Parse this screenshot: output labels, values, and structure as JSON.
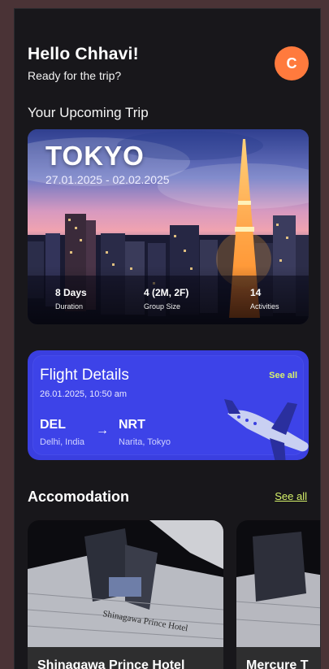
{
  "header": {
    "greeting": "Hello Chhavi!",
    "subtitle": "Ready for the trip?",
    "avatar_initial": "C"
  },
  "upcoming": {
    "section_title": "Your Upcoming Trip",
    "city": "TOKYO",
    "dates": "27.01.2025 - 02.02.2025",
    "stats": [
      {
        "value": "8 Days",
        "label": "Duration"
      },
      {
        "value": "4 (2M, 2F)",
        "label": "Group Size"
      },
      {
        "value": "14",
        "label": "Activities"
      }
    ]
  },
  "flight": {
    "title": "Flight Details",
    "see_all": "See all",
    "datetime": "26.01.2025, 10:50 am",
    "from_code": "DEL",
    "from_place": "Delhi, India",
    "arrow": "→",
    "to_code": "NRT",
    "to_place": "Narita, Tokyo",
    "accent": "#3a3fe0"
  },
  "accommodation": {
    "title": "Accomodation",
    "see_all": "See all",
    "hotels": [
      {
        "name": "Shinagawa Prince Hotel",
        "sign": "Shinagawa Prince Hotel"
      },
      {
        "name": "Mercure T"
      }
    ]
  },
  "colors": {
    "avatar": "#ff7a3d",
    "link": "#d6f26b",
    "background": "#18171b"
  }
}
